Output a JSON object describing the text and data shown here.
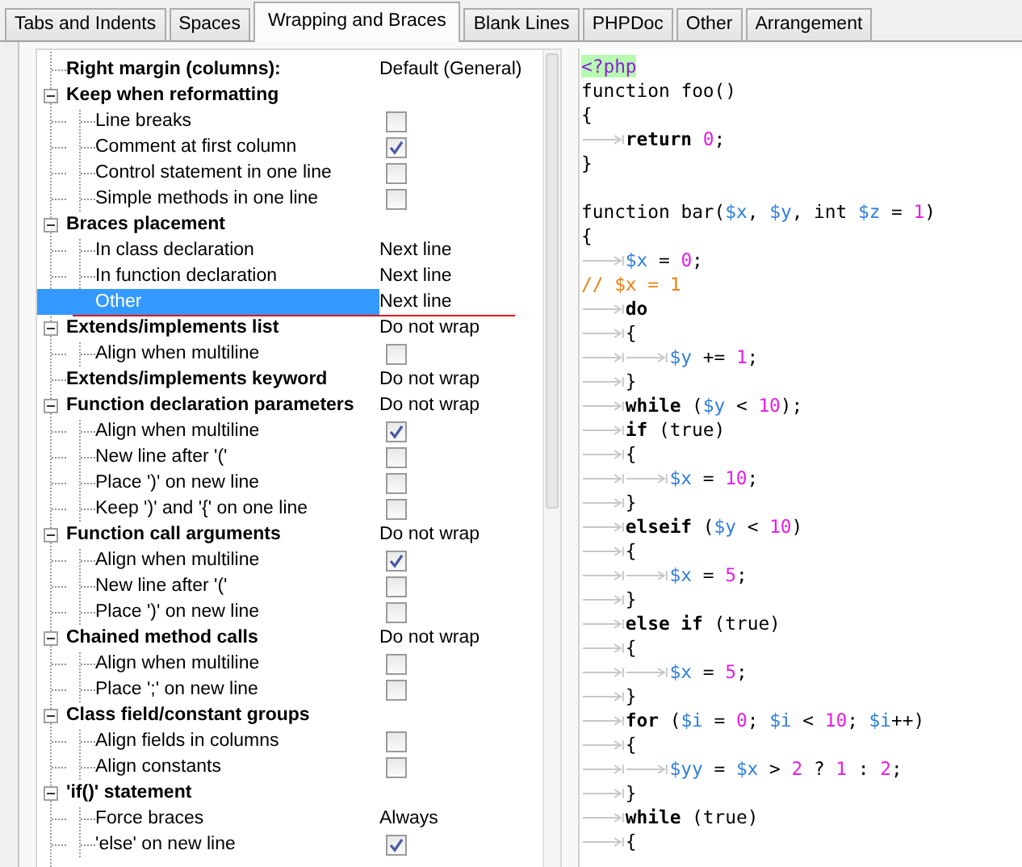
{
  "tabs": [
    {
      "label": "Tabs and Indents",
      "selected": false
    },
    {
      "label": "Spaces",
      "selected": false
    },
    {
      "label": "Wrapping and Braces",
      "selected": true
    },
    {
      "label": "Blank Lines",
      "selected": false
    },
    {
      "label": "PHPDoc",
      "selected": false
    },
    {
      "label": "Other",
      "selected": false
    },
    {
      "label": "Arrangement",
      "selected": false
    }
  ],
  "settings_tree": [
    {
      "label": "Right margin (columns):",
      "kind": "value",
      "value": "Default (General)",
      "selected": false
    },
    {
      "label": "Keep when reformatting",
      "kind": "none",
      "expanded": true,
      "selected": false,
      "children": [
        {
          "label": "Line breaks",
          "kind": "checkbox",
          "checked": false,
          "selected": false
        },
        {
          "label": "Comment at first column",
          "kind": "checkbox",
          "checked": true,
          "selected": false
        },
        {
          "label": "Control statement in one line",
          "kind": "checkbox",
          "checked": false,
          "selected": false
        },
        {
          "label": "Simple methods in one line",
          "kind": "checkbox",
          "checked": false,
          "selected": false
        }
      ]
    },
    {
      "label": "Braces placement",
      "kind": "none",
      "expanded": true,
      "selected": false,
      "children": [
        {
          "label": "In class declaration",
          "kind": "value",
          "value": "Next line",
          "selected": false
        },
        {
          "label": "In function declaration",
          "kind": "value",
          "value": "Next line",
          "selected": false
        },
        {
          "label": "Other",
          "kind": "value",
          "value": "Next line",
          "selected": true
        }
      ]
    },
    {
      "label": "Extends/implements list",
      "kind": "value",
      "value": "Do not wrap",
      "expanded": true,
      "selected": false,
      "children": [
        {
          "label": "Align when multiline",
          "kind": "checkbox",
          "checked": false,
          "selected": false
        }
      ]
    },
    {
      "label": "Extends/implements keyword",
      "kind": "value",
      "value": "Do not wrap",
      "selected": false
    },
    {
      "label": "Function declaration parameters",
      "kind": "value",
      "value": "Do not wrap",
      "expanded": true,
      "selected": false,
      "children": [
        {
          "label": "Align when multiline",
          "kind": "checkbox",
          "checked": true,
          "selected": false
        },
        {
          "label": "New line after '('",
          "kind": "checkbox",
          "checked": false,
          "selected": false
        },
        {
          "label": "Place ')' on new line",
          "kind": "checkbox",
          "checked": false,
          "selected": false
        },
        {
          "label": "Keep ')' and '{' on one line",
          "kind": "checkbox",
          "checked": false,
          "selected": false
        }
      ]
    },
    {
      "label": "Function call arguments",
      "kind": "value",
      "value": "Do not wrap",
      "expanded": true,
      "selected": false,
      "children": [
        {
          "label": "Align when multiline",
          "kind": "checkbox",
          "checked": true,
          "selected": false
        },
        {
          "label": "New line after '('",
          "kind": "checkbox",
          "checked": false,
          "selected": false
        },
        {
          "label": "Place ')' on new line",
          "kind": "checkbox",
          "checked": false,
          "selected": false
        }
      ]
    },
    {
      "label": "Chained method calls",
      "kind": "value",
      "value": "Do not wrap",
      "expanded": true,
      "selected": false,
      "children": [
        {
          "label": "Align when multiline",
          "kind": "checkbox",
          "checked": false,
          "selected": false
        },
        {
          "label": "Place ';' on new line",
          "kind": "checkbox",
          "checked": false,
          "selected": false
        }
      ]
    },
    {
      "label": "Class field/constant groups",
      "kind": "none",
      "expanded": true,
      "selected": false,
      "children": [
        {
          "label": "Align fields in columns",
          "kind": "checkbox",
          "checked": false,
          "selected": false
        },
        {
          "label": "Align constants",
          "kind": "checkbox",
          "checked": false,
          "selected": false
        }
      ]
    },
    {
      "label": "'if()' statement",
      "kind": "none",
      "expanded": true,
      "selected": false,
      "children": [
        {
          "label": "Force braces",
          "kind": "value",
          "value": "Always",
          "selected": false
        },
        {
          "label": "'else' on new line",
          "kind": "checkbox",
          "checked": true,
          "selected": false
        }
      ]
    }
  ],
  "code_preview": [
    {
      "kind": "code",
      "tokens": [
        {
          "kind": "tag",
          "text": "<?php"
        }
      ]
    },
    {
      "kind": "code",
      "tokens": [
        {
          "kind": "plain",
          "text": "function foo()"
        }
      ]
    },
    {
      "kind": "code",
      "tokens": [
        {
          "kind": "plain",
          "text": "{"
        }
      ]
    },
    {
      "kind": "code",
      "indent": [
        {
          "kind": "tab"
        }
      ],
      "tokens": [
        {
          "kind": "keyword",
          "text": "return "
        },
        {
          "kind": "number",
          "text": "0"
        },
        {
          "kind": "plain",
          "text": ";"
        }
      ]
    },
    {
      "kind": "code",
      "tokens": [
        {
          "kind": "plain",
          "text": "}"
        }
      ]
    },
    {
      "kind": "blank"
    },
    {
      "kind": "code",
      "tokens": [
        {
          "kind": "plain",
          "text": "function bar("
        },
        {
          "kind": "var",
          "text": "$x"
        },
        {
          "kind": "plain",
          "text": ", "
        },
        {
          "kind": "var",
          "text": "$y"
        },
        {
          "kind": "plain",
          "text": ", int "
        },
        {
          "kind": "var",
          "text": "$z"
        },
        {
          "kind": "plain",
          "text": " = "
        },
        {
          "kind": "number",
          "text": "1"
        },
        {
          "kind": "plain",
          "text": ")"
        }
      ]
    },
    {
      "kind": "code",
      "tokens": [
        {
          "kind": "plain",
          "text": "{"
        }
      ]
    },
    {
      "kind": "code",
      "indent": [
        {
          "kind": "tab"
        }
      ],
      "tokens": [
        {
          "kind": "var",
          "text": "$x"
        },
        {
          "kind": "plain",
          "text": " = "
        },
        {
          "kind": "number",
          "text": "0"
        },
        {
          "kind": "plain",
          "text": ";"
        }
      ]
    },
    {
      "kind": "code",
      "tokens": [
        {
          "kind": "comment",
          "text": "// $x = 1"
        }
      ]
    },
    {
      "kind": "code",
      "indent": [
        {
          "kind": "tab"
        }
      ],
      "tokens": [
        {
          "kind": "keyword",
          "text": "do"
        }
      ]
    },
    {
      "kind": "code",
      "indent": [
        {
          "kind": "tab"
        }
      ],
      "tokens": [
        {
          "kind": "plain",
          "text": "{"
        }
      ]
    },
    {
      "kind": "code",
      "indent": [
        {
          "kind": "tab"
        },
        {
          "kind": "tab"
        }
      ],
      "tokens": [
        {
          "kind": "var",
          "text": "$y"
        },
        {
          "kind": "plain",
          "text": " += "
        },
        {
          "kind": "number",
          "text": "1"
        },
        {
          "kind": "plain",
          "text": ";"
        }
      ]
    },
    {
      "kind": "code",
      "indent": [
        {
          "kind": "tab"
        }
      ],
      "tokens": [
        {
          "kind": "plain",
          "text": "}"
        }
      ]
    },
    {
      "kind": "code",
      "indent": [
        {
          "kind": "tab"
        }
      ],
      "tokens": [
        {
          "kind": "keyword",
          "text": "while"
        },
        {
          "kind": "plain",
          "text": " ("
        },
        {
          "kind": "var",
          "text": "$y"
        },
        {
          "kind": "plain",
          "text": " < "
        },
        {
          "kind": "number",
          "text": "10"
        },
        {
          "kind": "plain",
          "text": ");"
        }
      ]
    },
    {
      "kind": "code",
      "indent": [
        {
          "kind": "tab"
        }
      ],
      "tokens": [
        {
          "kind": "keyword",
          "text": "if"
        },
        {
          "kind": "plain",
          "text": " (true)"
        }
      ]
    },
    {
      "kind": "code",
      "indent": [
        {
          "kind": "tab"
        }
      ],
      "tokens": [
        {
          "kind": "plain",
          "text": "{"
        }
      ]
    },
    {
      "kind": "code",
      "indent": [
        {
          "kind": "tab"
        },
        {
          "kind": "tab"
        }
      ],
      "tokens": [
        {
          "kind": "var",
          "text": "$x"
        },
        {
          "kind": "plain",
          "text": " = "
        },
        {
          "kind": "number",
          "text": "10"
        },
        {
          "kind": "plain",
          "text": ";"
        }
      ]
    },
    {
      "kind": "code",
      "indent": [
        {
          "kind": "tab"
        }
      ],
      "tokens": [
        {
          "kind": "plain",
          "text": "}"
        }
      ]
    },
    {
      "kind": "code",
      "indent": [
        {
          "kind": "tab"
        }
      ],
      "tokens": [
        {
          "kind": "keyword",
          "text": "elseif"
        },
        {
          "kind": "plain",
          "text": " ("
        },
        {
          "kind": "var",
          "text": "$y"
        },
        {
          "kind": "plain",
          "text": " < "
        },
        {
          "kind": "number",
          "text": "10"
        },
        {
          "kind": "plain",
          "text": ")"
        }
      ]
    },
    {
      "kind": "code",
      "indent": [
        {
          "kind": "tab"
        }
      ],
      "tokens": [
        {
          "kind": "plain",
          "text": "{"
        }
      ]
    },
    {
      "kind": "code",
      "indent": [
        {
          "kind": "tab"
        },
        {
          "kind": "tab"
        }
      ],
      "tokens": [
        {
          "kind": "var",
          "text": "$x"
        },
        {
          "kind": "plain",
          "text": " = "
        },
        {
          "kind": "number",
          "text": "5"
        },
        {
          "kind": "plain",
          "text": ";"
        }
      ]
    },
    {
      "kind": "code",
      "indent": [
        {
          "kind": "tab"
        }
      ],
      "tokens": [
        {
          "kind": "plain",
          "text": "}"
        }
      ]
    },
    {
      "kind": "code",
      "indent": [
        {
          "kind": "tab"
        }
      ],
      "tokens": [
        {
          "kind": "keyword",
          "text": "else if"
        },
        {
          "kind": "plain",
          "text": " (true)"
        }
      ]
    },
    {
      "kind": "code",
      "indent": [
        {
          "kind": "tab"
        }
      ],
      "tokens": [
        {
          "kind": "plain",
          "text": "{"
        }
      ]
    },
    {
      "kind": "code",
      "indent": [
        {
          "kind": "tab"
        },
        {
          "kind": "tab"
        }
      ],
      "tokens": [
        {
          "kind": "var",
          "text": "$x"
        },
        {
          "kind": "plain",
          "text": " = "
        },
        {
          "kind": "number",
          "text": "5"
        },
        {
          "kind": "plain",
          "text": ";"
        }
      ]
    },
    {
      "kind": "code",
      "indent": [
        {
          "kind": "tab"
        }
      ],
      "tokens": [
        {
          "kind": "plain",
          "text": "}"
        }
      ]
    },
    {
      "kind": "code",
      "indent": [
        {
          "kind": "tab"
        }
      ],
      "tokens": [
        {
          "kind": "keyword",
          "text": "for"
        },
        {
          "kind": "plain",
          "text": " ("
        },
        {
          "kind": "var",
          "text": "$i"
        },
        {
          "kind": "plain",
          "text": " = "
        },
        {
          "kind": "number",
          "text": "0"
        },
        {
          "kind": "plain",
          "text": "; "
        },
        {
          "kind": "var",
          "text": "$i"
        },
        {
          "kind": "plain",
          "text": " < "
        },
        {
          "kind": "number",
          "text": "10"
        },
        {
          "kind": "plain",
          "text": "; "
        },
        {
          "kind": "var",
          "text": "$i"
        },
        {
          "kind": "plain",
          "text": "++)"
        }
      ]
    },
    {
      "kind": "code",
      "indent": [
        {
          "kind": "tab"
        }
      ],
      "tokens": [
        {
          "kind": "plain",
          "text": "{"
        }
      ]
    },
    {
      "kind": "code",
      "indent": [
        {
          "kind": "tab"
        },
        {
          "kind": "tab"
        }
      ],
      "tokens": [
        {
          "kind": "var",
          "text": "$yy"
        },
        {
          "kind": "plain",
          "text": " = "
        },
        {
          "kind": "var",
          "text": "$x"
        },
        {
          "kind": "plain",
          "text": " > "
        },
        {
          "kind": "number",
          "text": "2"
        },
        {
          "kind": "plain",
          "text": " ? "
        },
        {
          "kind": "number",
          "text": "1"
        },
        {
          "kind": "plain",
          "text": " : "
        },
        {
          "kind": "number",
          "text": "2"
        },
        {
          "kind": "plain",
          "text": ";"
        }
      ]
    },
    {
      "kind": "code",
      "indent": [
        {
          "kind": "tab"
        }
      ],
      "tokens": [
        {
          "kind": "plain",
          "text": "}"
        }
      ]
    },
    {
      "kind": "code",
      "indent": [
        {
          "kind": "tab"
        }
      ],
      "tokens": [
        {
          "kind": "keyword",
          "text": "while"
        },
        {
          "kind": "plain",
          "text": " (true)"
        }
      ]
    },
    {
      "kind": "code",
      "indent": [
        {
          "kind": "tab"
        }
      ],
      "tokens": [
        {
          "kind": "plain",
          "text": "{"
        }
      ]
    }
  ]
}
